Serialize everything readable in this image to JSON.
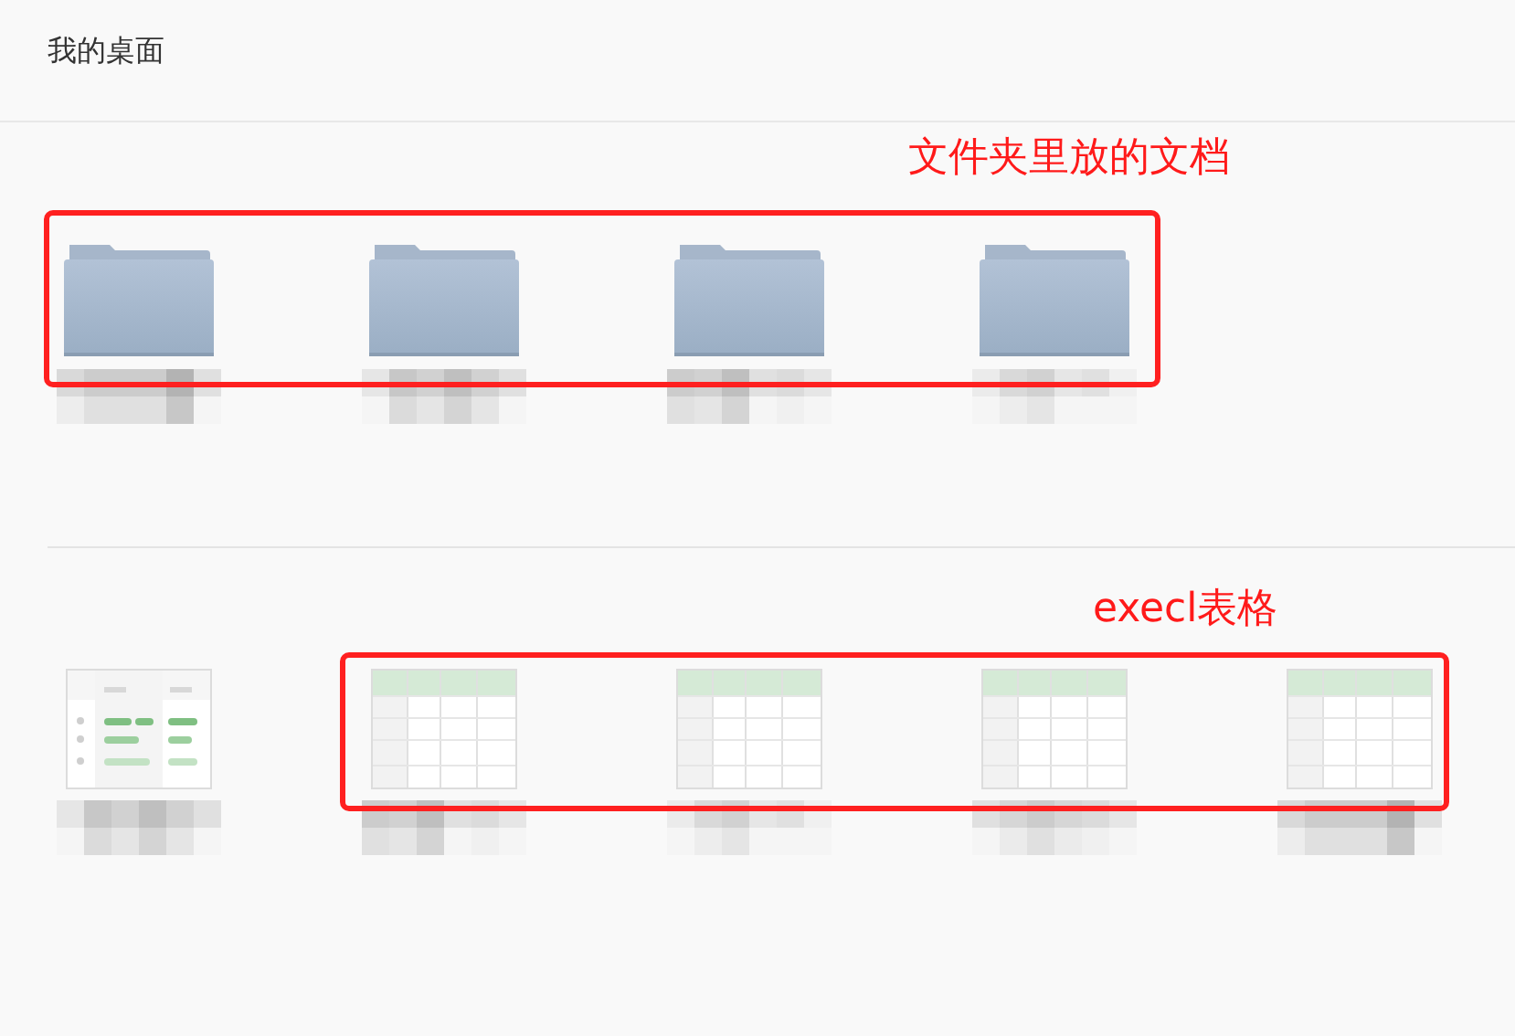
{
  "header": {
    "title": "我的桌面"
  },
  "folder_section": {
    "annotation": "文件夹里放的文档",
    "items": [
      {
        "kind": "folder"
      },
      {
        "kind": "folder"
      },
      {
        "kind": "folder"
      },
      {
        "kind": "folder"
      }
    ]
  },
  "file_section": {
    "annotation": "execl表格",
    "items": [
      {
        "kind": "form"
      },
      {
        "kind": "sheet"
      },
      {
        "kind": "sheet"
      },
      {
        "kind": "sheet"
      },
      {
        "kind": "sheet"
      }
    ]
  }
}
